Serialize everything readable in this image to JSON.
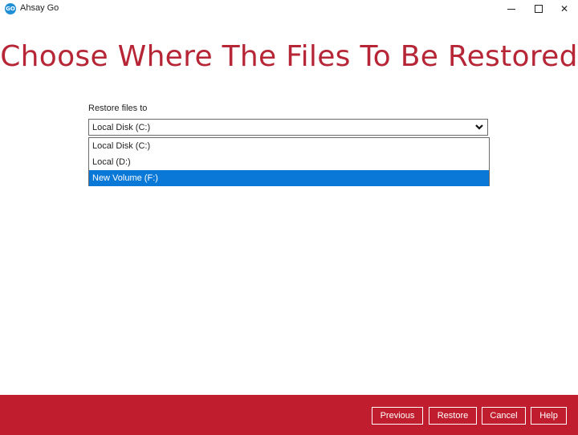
{
  "window": {
    "title": "Ahsay Go",
    "icon_text": "GO",
    "icon_color": "#1f8fd6",
    "controls": {
      "minimize": "minimize-icon",
      "maximize": "maximize-icon",
      "close": "close-icon"
    }
  },
  "page": {
    "title": "Choose Where The Files To Be Restored",
    "title_color": "#b62636"
  },
  "restore": {
    "label": "Restore files to",
    "selected_value": "Local Disk (C:)",
    "options": [
      {
        "label": "Local Disk (C:)",
        "highlighted": false
      },
      {
        "label": "Local (D:)",
        "highlighted": false
      },
      {
        "label": "New Volume (F:)",
        "highlighted": true
      }
    ],
    "highlight_color": "#0a78d7"
  },
  "footer": {
    "background": "#c01e2e",
    "buttons": {
      "previous": "Previous",
      "restore": "Restore",
      "cancel": "Cancel",
      "help": "Help"
    }
  }
}
